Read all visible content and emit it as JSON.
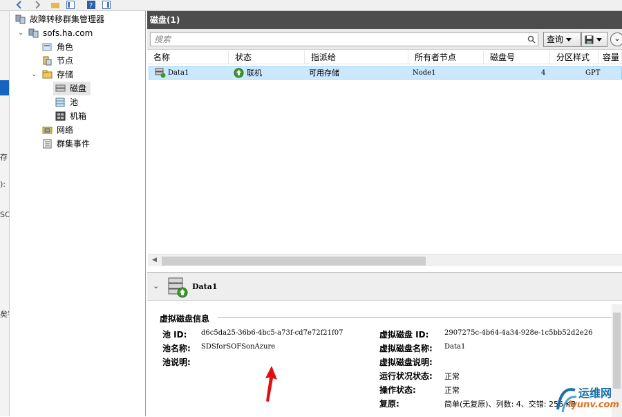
{
  "colors": {
    "header_bg": "#4d4d4d",
    "selection_bg": "#cce8ff",
    "tree_selection_bg": "#e5e5e5",
    "arrow_red": "#e01010",
    "online_green": "#3c9a2b"
  },
  "background_window": {
    "fragments": [
      "存",
      "):",
      "SC",
      "矣针"
    ]
  },
  "tree": {
    "root": "故障转移群集管理器",
    "cluster": "sofs.ha.com",
    "roles": "角色",
    "nodes": "节点",
    "storage": "存储",
    "disks": "磁盘",
    "pools": "池",
    "enclosures": "机箱",
    "networks": "网络",
    "cluster_events": "群集事件"
  },
  "main": {
    "title": "磁盘(1)",
    "search_placeholder": "搜索",
    "query_label": "查询"
  },
  "table": {
    "columns": [
      "名称",
      "状态",
      "指派给",
      "所有者节点",
      "磁盘号",
      "分区样式",
      "容量"
    ],
    "rows": [
      {
        "name": "Data1",
        "status": "联机",
        "assigned_to": "可用存储",
        "owner_node": "Node1",
        "disk_number": "4",
        "partition_style": "GPT"
      }
    ]
  },
  "details": {
    "title": "Data1",
    "group_title": "虚拟磁盘信息",
    "pool_id_label": "池 ID:",
    "pool_id": "d6c5da25-36b6-4bc5-a73f-cd7e72f21f07",
    "pool_name_label": "池名称:",
    "pool_name": "SDSforSOFSonAzure",
    "pool_desc_label": "池说明:",
    "vdisk_id_label": "虚拟磁盘 ID:",
    "vdisk_id": "2907275c-4b64-4a34-928e-1c5bb52d2e26",
    "vdisk_name_label": "虚拟磁盘名称:",
    "vdisk_name": "Data1",
    "vdisk_desc_label": "虚拟磁盘说明:",
    "health_label": "运行状况状态:",
    "health": "正常",
    "op_label": "操作状态:",
    "op": "正常",
    "resiliency_label": "复原:",
    "resiliency": "简单(无复原)、列数: 4、交错: 256 KB"
  },
  "watermark": {
    "cn": "运维网",
    "en": "iyunv.com"
  }
}
